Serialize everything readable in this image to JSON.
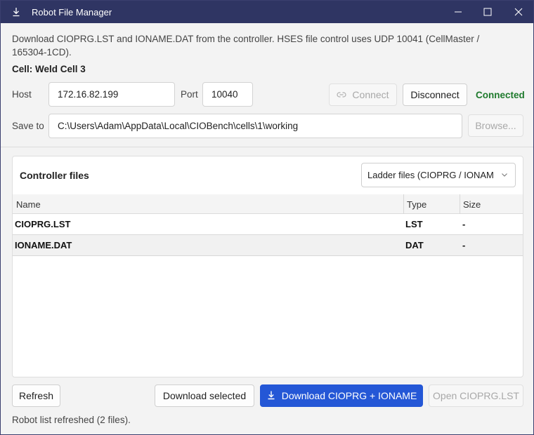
{
  "window": {
    "title": "Robot File Manager"
  },
  "description": "Download CIOPRG.LST and IONAME.DAT from the controller. HSES file control uses UDP 10041 (CellMaster / 165304-1CD).",
  "cell_label": "Cell: Weld Cell 3",
  "connection": {
    "host_label": "Host",
    "host_value": "172.16.82.199",
    "port_label": "Port",
    "port_value": "10040",
    "connect_label": "Connect",
    "disconnect_label": "Disconnect",
    "status": "Connected",
    "status_color": "#1e7a2c"
  },
  "save": {
    "label": "Save to",
    "path": "C:\\Users\\Adam\\AppData\\Local\\CIOBench\\cells\\1\\working",
    "browse_label": "Browse..."
  },
  "files_panel": {
    "title": "Controller files",
    "filter_selected": "Ladder files (CIOPRG / IONAM",
    "columns": [
      "Name",
      "Type",
      "Size"
    ],
    "rows": [
      {
        "name": "CIOPRG.LST",
        "type": "LST",
        "size": "-"
      },
      {
        "name": "IONAME.DAT",
        "type": "DAT",
        "size": "-"
      }
    ]
  },
  "actions": {
    "refresh_label": "Refresh",
    "download_selected_label": "Download selected",
    "download_main_label": "Download CIOPRG + IONAME",
    "open_label": "Open CIOPRG.LST"
  },
  "status_text": "Robot list refreshed (2 files).",
  "colors": {
    "titlebar": "#2f3563",
    "primary": "#2457d6"
  }
}
